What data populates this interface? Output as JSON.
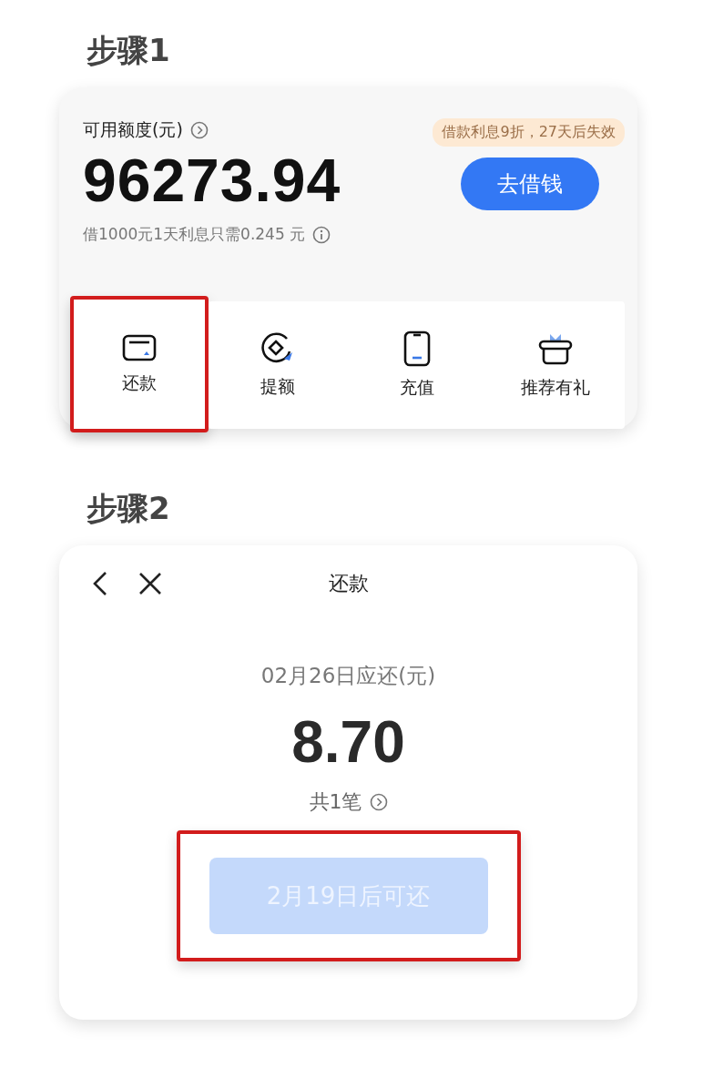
{
  "steps": [
    {
      "title": "步骤1",
      "kind": "home",
      "credit_label": "可用额度(元)",
      "promo_badge": "借款利息9折，27天后失效",
      "amount": "96273.94",
      "borrow_button": "去借钱",
      "interest_note": "借1000元1天利息只需0.245 元",
      "actions": [
        {
          "label": "还款",
          "kind": "card",
          "highlighted": true
        },
        {
          "label": "提额",
          "kind": "coin",
          "highlighted": false
        },
        {
          "label": "充值",
          "kind": "phone",
          "highlighted": false
        },
        {
          "label": "推荐有礼",
          "kind": "gift",
          "highlighted": false
        }
      ]
    },
    {
      "title": "步骤2",
      "kind": "repay",
      "page_title": "还款",
      "due_label": "02月26日应还(元)",
      "amount": "8.70",
      "count": "共1笔",
      "repay_button": {
        "label": "2月19日后可还",
        "disabled": true,
        "highlighted": true
      }
    }
  ]
}
